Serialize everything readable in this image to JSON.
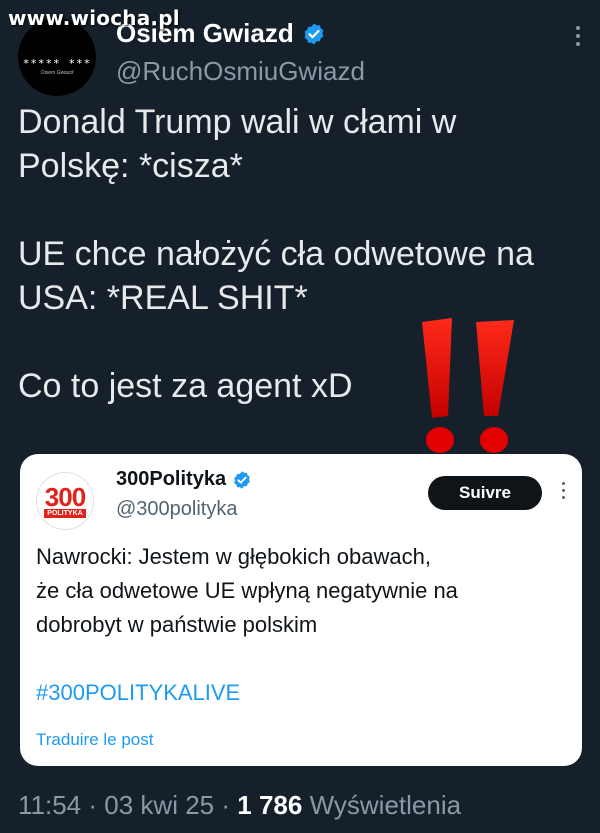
{
  "watermark": "www.wiocha.pl",
  "author": {
    "display_name": "Osiem Gwiazd",
    "handle": "@RuchOsmiuGwiazd",
    "avatar_text": "***** ***",
    "avatar_subtext": "Osiem Gwiazd",
    "verified_icon": "verified-badge-icon"
  },
  "tweet": {
    "paragraphs": [
      [
        "Donald Trump wali w cłami w",
        "Polskę: *cisza*"
      ],
      [
        "UE chce nałożyć cła odwetowe na",
        "USA: *REAL SHIT*"
      ],
      [
        "Co to jest za agent xD"
      ]
    ]
  },
  "quote": {
    "avatar_number": "300",
    "avatar_label": "POLITYKA",
    "name": "300Polityka",
    "handle": "@300polityka",
    "follow_label": "Suivre",
    "text_lines": [
      "Nawrocki: Jestem w głębokich obawach,",
      "że cła odwetowe UE wpłyną negatywnie na",
      "dobrobyt w państwie polskim"
    ],
    "hashtag": "#300POLITYKALIVE",
    "translate_label": "Traduire le post"
  },
  "meta": {
    "time": "11:54",
    "sep1": "·",
    "date": "03 kwi 25",
    "sep2": "·",
    "views_count": "1 786",
    "views_label": "Wyświetlenia"
  },
  "colors": {
    "background": "#15202b",
    "accent": "#1d9bf0",
    "exclamation": "#e30000"
  }
}
